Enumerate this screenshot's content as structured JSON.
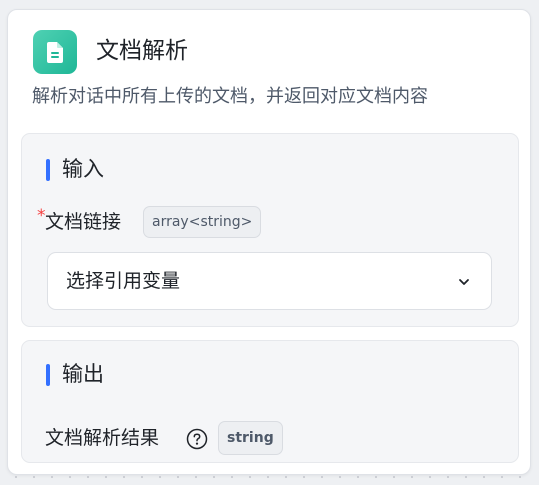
{
  "node": {
    "icon": "document-icon",
    "title": "文档解析",
    "description": "解析对话中所有上传的文档，并返回对应文档内容",
    "accent_color": "#1fb797"
  },
  "input_section": {
    "title": "输入",
    "accent_color": "#3370ff",
    "field": {
      "required_mark": "*",
      "label": "文档链接",
      "type": "array<string>",
      "select_value": "选择引用变量",
      "select_icon": "chevron-down-icon"
    }
  },
  "output_section": {
    "title": "输出",
    "accent_color": "#3370ff",
    "field": {
      "label": "文档解析结果",
      "help_icon": "question-circle-icon",
      "type": "string"
    }
  }
}
